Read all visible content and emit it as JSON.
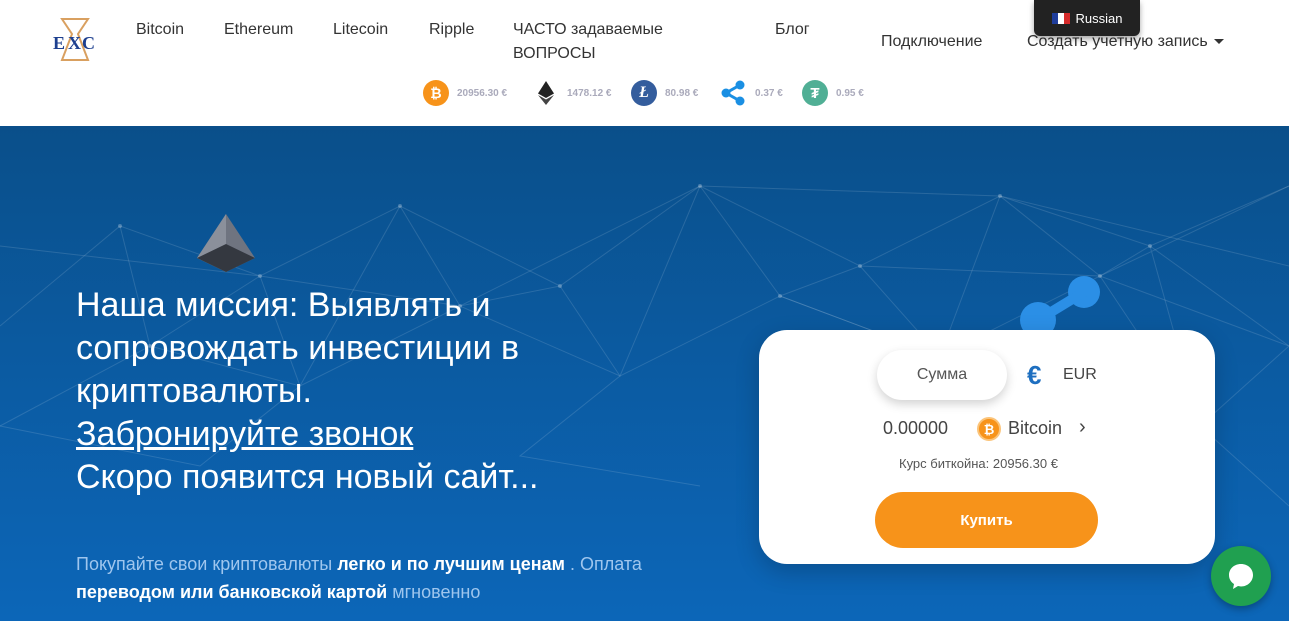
{
  "nav": {
    "items": [
      "Bitcoin",
      "Ethereum",
      "Litecoin",
      "Ripple",
      "ЧАСТО задаваемые ВОПРОСЫ",
      "Блог"
    ],
    "login": "Подключение",
    "signup": "Создать учетную запись",
    "language": "Russian"
  },
  "ticker": [
    {
      "icon": "bitcoin-icon",
      "price": "20956.30 €",
      "color": "#f7931a"
    },
    {
      "icon": "ethereum-icon",
      "price": "1478.12 €",
      "color": "#111111"
    },
    {
      "icon": "litecoin-icon",
      "price": "80.98 €",
      "color": "#345d9d"
    },
    {
      "icon": "ripple-icon",
      "price": "0.37 €",
      "color": "#1a8fe3"
    },
    {
      "icon": "tether-icon",
      "price": "0.95 €",
      "color": "#50af95"
    }
  ],
  "hero": {
    "line1": "Наша миссия: Выявлять и",
    "line2": "сопровождать инвестиции в",
    "line3": "криптовалюты.",
    "link": "Забронируйте звонок",
    "line5": "Скоро появится новый сайт...",
    "sub_1": "Покупайте свои криптовалюты ",
    "sub_b1": "легко и по лучшим ценам",
    "sub_2": " . Оплата ",
    "sub_b2": "переводом или банковской картой",
    "sub_3": " мгновенно"
  },
  "widget": {
    "amount_placeholder": "Сумма",
    "currency": "EUR",
    "crypto_amount": "0.00000",
    "crypto_name": "Bitcoin",
    "rate": "Курс биткойна: 20956.30 €",
    "buy": "Купить"
  },
  "colors": {
    "accent": "#f7931a",
    "hero_top": "#0a4f8a",
    "hero_bottom": "#0c66b8",
    "chat": "#20a050"
  }
}
